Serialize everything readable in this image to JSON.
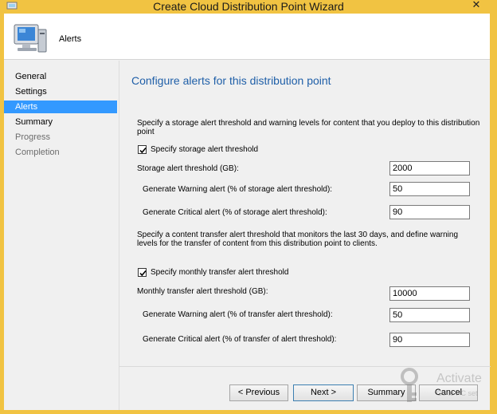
{
  "window": {
    "title": "Create Cloud Distribution Point Wizard",
    "close_label": "✕",
    "accent_color": "#f1c342"
  },
  "header": {
    "page_name": "Alerts",
    "icon": "computer-wizard-icon"
  },
  "nav": {
    "items": [
      {
        "label": "General",
        "state": "normal"
      },
      {
        "label": "Settings",
        "state": "normal"
      },
      {
        "label": "Alerts",
        "state": "selected"
      },
      {
        "label": "Summary",
        "state": "normal"
      },
      {
        "label": "Progress",
        "state": "disabled"
      },
      {
        "label": "Completion",
        "state": "disabled"
      }
    ]
  },
  "main": {
    "heading": "Configure alerts for this distribution point",
    "storage_desc_line1": "Specify a storage alert threshold and warning levels for content that you deploy to this distribution",
    "storage_desc_line2": "point",
    "storage_check_label": "Specify storage alert threshold",
    "storage_threshold_label": "Storage alert threshold (GB):",
    "storage_threshold_value": "2000",
    "storage_warning_label": "Generate Warning alert (% of storage alert threshold):",
    "storage_warning_value": "50",
    "storage_critical_label": "Generate Critical alert (% of storage alert threshold):",
    "storage_critical_value": "90",
    "transfer_desc_line1": "Specify a content transfer alert threshold that monitors the last 30 days, and define warning",
    "transfer_desc_line2": "levels for the transfer of content from this distribution point to clients.",
    "transfer_check_label": "Specify monthly transfer alert threshold",
    "transfer_threshold_label": "Monthly transfer alert threshold (GB):",
    "transfer_threshold_value": "10000",
    "transfer_warning_label": "Generate Warning alert (% of transfer alert threshold):",
    "transfer_warning_value": "50",
    "transfer_critical_label": "Generate Critical alert (% of transfer of alert threshold):",
    "transfer_critical_value": "90"
  },
  "buttons": {
    "previous": "< Previous",
    "next": "Next >",
    "summary": "Summary",
    "cancel": "Cancel"
  },
  "watermark": {
    "text": "Activate",
    "sub": "Go to PC set"
  }
}
